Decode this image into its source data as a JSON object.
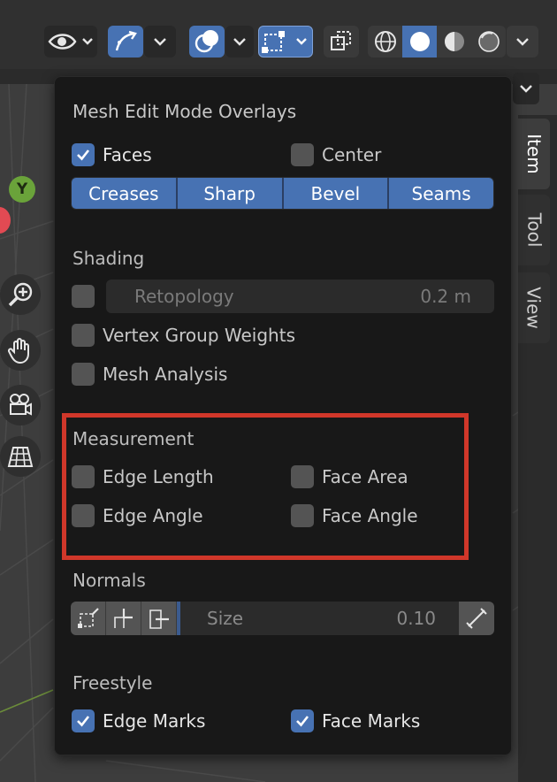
{
  "popover": {
    "title": "Mesh Edit Mode Overlays",
    "faces_label": "Faces",
    "faces_checked": true,
    "center_label": "Center",
    "center_checked": false,
    "edge_buttons": [
      "Creases",
      "Sharp",
      "Bevel",
      "Seams"
    ],
    "shading": {
      "title": "Shading",
      "retopology_label": "Retopology",
      "retopology_value": "0.2 m",
      "vertex_group_weights_label": "Vertex Group Weights",
      "mesh_analysis_label": "Mesh Analysis"
    },
    "measurement": {
      "title": "Measurement",
      "edge_length_label": "Edge Length",
      "face_area_label": "Face Area",
      "edge_angle_label": "Edge Angle",
      "face_angle_label": "Face Angle"
    },
    "normals": {
      "title": "Normals",
      "size_label": "Size",
      "size_value": "0.10"
    },
    "freestyle": {
      "title": "Freestyle",
      "edge_marks_label": "Edge Marks",
      "edge_marks_checked": true,
      "face_marks_label": "Face Marks",
      "face_marks_checked": true
    }
  },
  "sidebar_tabs": [
    "Item",
    "Tool",
    "View"
  ],
  "gizmo": {
    "y_axis_label": "Y"
  },
  "colors": {
    "accent": "#4772b3",
    "highlight_box": "#d0372a",
    "y_axis": "#6aa33a",
    "x_axis": "#e24a53"
  }
}
